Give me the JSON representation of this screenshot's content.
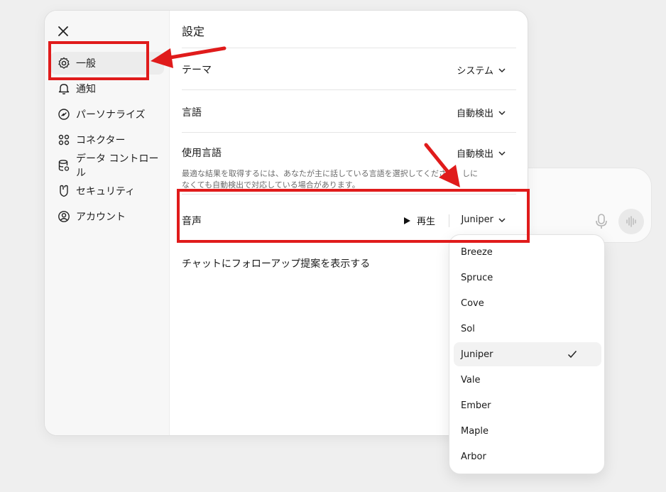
{
  "modal": {
    "title": "設定",
    "close_label": "×"
  },
  "sidebar": {
    "items": [
      {
        "label": "一般",
        "icon": "gear-icon",
        "active": true
      },
      {
        "label": "通知",
        "icon": "bell-icon"
      },
      {
        "label": "パーソナライズ",
        "icon": "personalize-icon"
      },
      {
        "label": "コネクター",
        "icon": "connector-icon"
      },
      {
        "label": "データ コントロール",
        "icon": "database-icon"
      },
      {
        "label": "セキュリティ",
        "icon": "shield-icon"
      },
      {
        "label": "アカウント",
        "icon": "user-circle-icon"
      }
    ]
  },
  "settings": {
    "theme": {
      "label": "テーマ",
      "value": "システム"
    },
    "language": {
      "label": "言語",
      "value": "自動検出"
    },
    "spoken_language": {
      "label": "使用言語",
      "value": "自動検出",
      "description": "最適な結果を取得するには、あなたが主に話している言語を選択してください。しになくても自動検出で対応している場合があります。"
    },
    "voice": {
      "label": "音声",
      "play_label": "再生",
      "value": "Juniper"
    },
    "followup": {
      "label": "チャットにフォローアップ提案を表示する"
    }
  },
  "voice_dropdown": {
    "options": [
      "Breeze",
      "Spruce",
      "Cove",
      "Sol",
      "Juniper",
      "Vale",
      "Ember",
      "Maple",
      "Arbor"
    ],
    "selected": "Juniper"
  },
  "colors": {
    "annotation_red": "#e01b1b",
    "background": "#efefef"
  }
}
